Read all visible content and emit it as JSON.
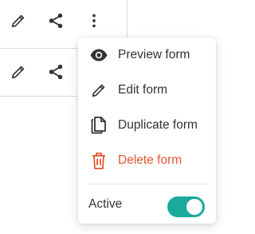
{
  "rows": [
    {
      "icons": [
        "pencil-icon",
        "share-icon",
        "more-vertical-icon"
      ]
    },
    {
      "icons": [
        "pencil-icon",
        "share-icon"
      ]
    }
  ],
  "menu": {
    "items": [
      {
        "label": "Preview form",
        "icon": "eye-icon"
      },
      {
        "label": "Edit form",
        "icon": "pencil-icon"
      },
      {
        "label": "Duplicate form",
        "icon": "copy-icon"
      },
      {
        "label": "Delete form",
        "icon": "trash-icon",
        "color": "#e4572e"
      }
    ],
    "active_label": "Active",
    "active_toggle_on": true
  },
  "colors": {
    "accent": "#1aa99a",
    "danger": "#e4572e",
    "text": "#333333"
  }
}
